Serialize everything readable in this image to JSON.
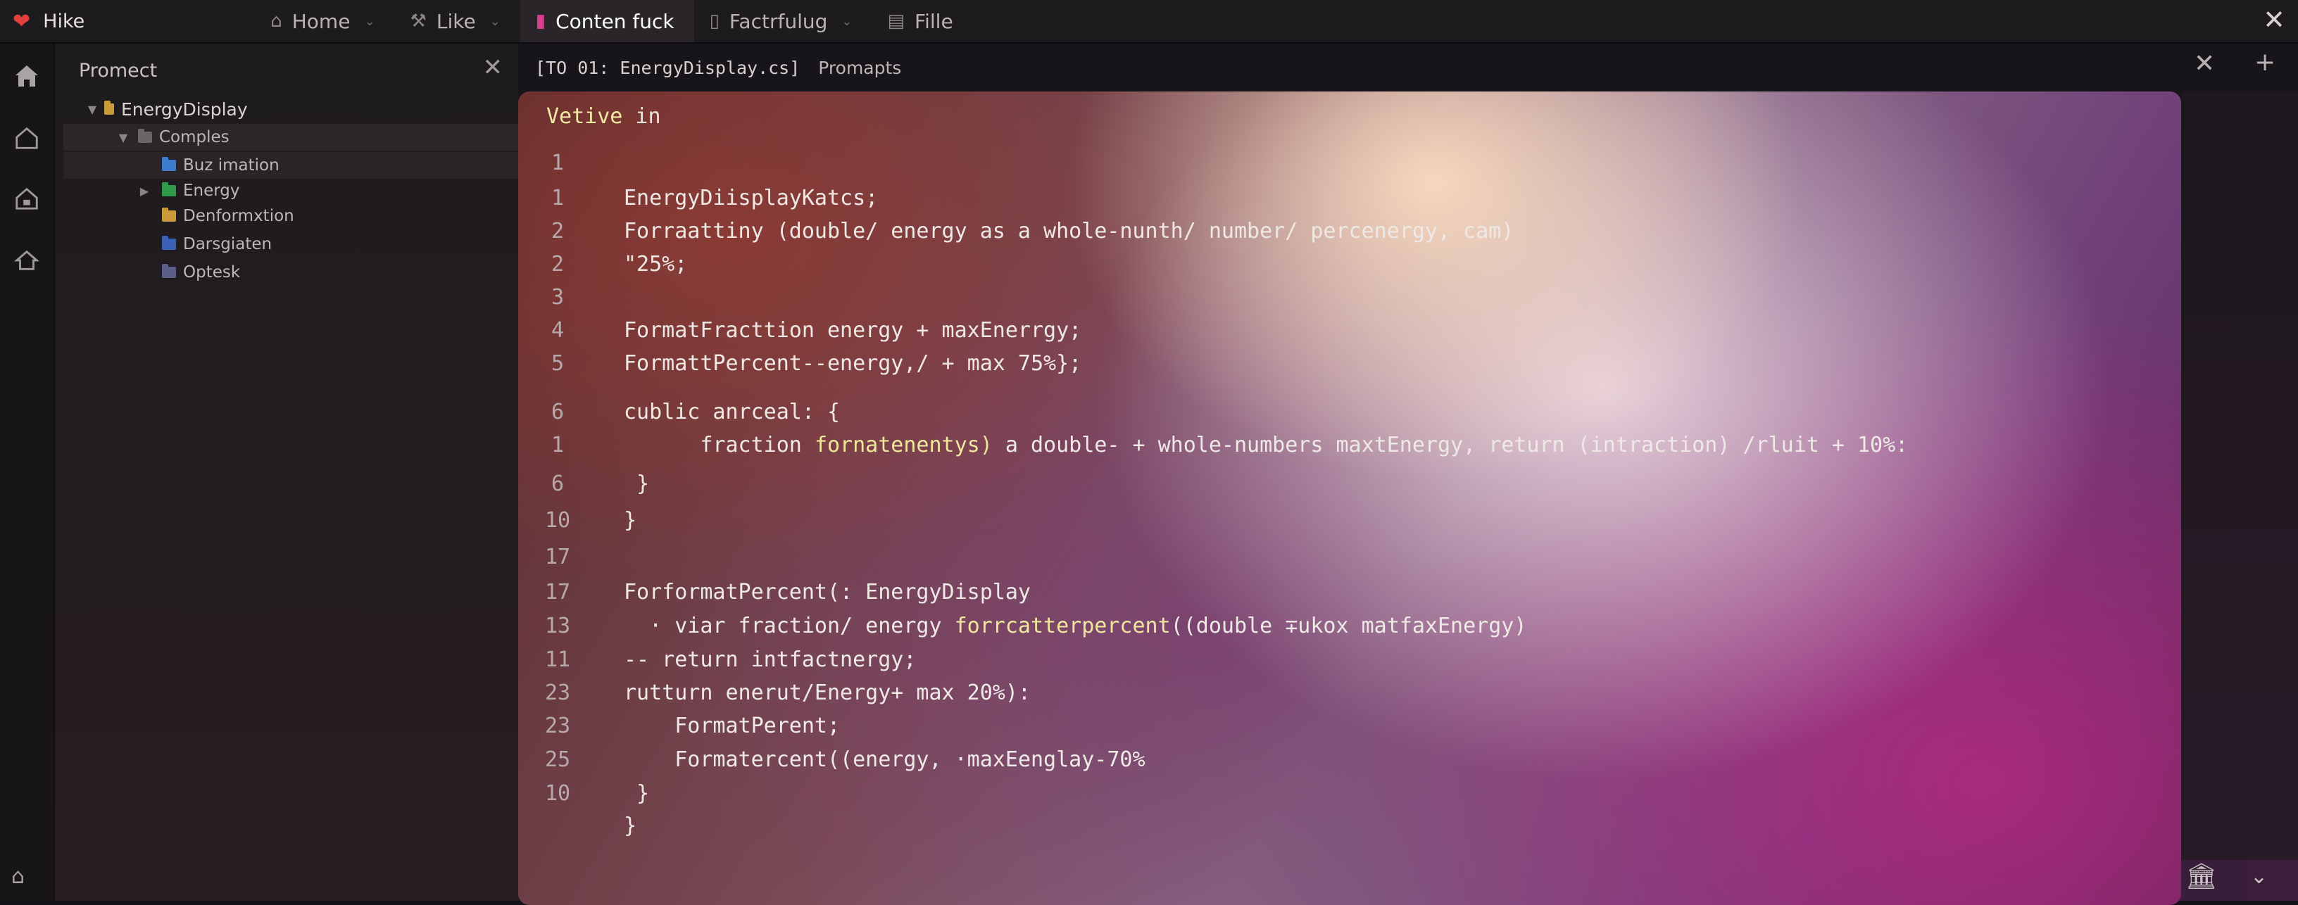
{
  "app": {
    "name": "Hike"
  },
  "tabs": [
    {
      "label": "Home",
      "icon": "home-icon",
      "chevron": true
    },
    {
      "label": "Like",
      "icon": "hammer-icon",
      "chevron": true
    },
    {
      "label": "Conten fuck",
      "icon": "bookmark-icon",
      "active": true,
      "chevron": false
    },
    {
      "label": "Factrfulug",
      "icon": "tablet-icon",
      "chevron": true
    },
    {
      "label": "Fille",
      "icon": "file-icon",
      "chevron": false
    }
  ],
  "sidebar": {
    "title": "Promect",
    "tree": [
      {
        "label": "EnergyDisplay",
        "expanded": true,
        "color": "#c99a3a"
      },
      {
        "label": "Comples",
        "expanded": true,
        "color": "#6b6566"
      },
      {
        "label": "Buz imation",
        "color": "#3c7bd0"
      },
      {
        "label": "Energy",
        "collapsed": true,
        "color": "#2f9a4a"
      },
      {
        "label": "Denformxtion",
        "color": "#c99a3a"
      },
      {
        "label": "Darsgiaten",
        "color": "#3c62b8"
      },
      {
        "label": "Optesk",
        "color": "#5a5f8a"
      }
    ]
  },
  "editor": {
    "tab_file": "[TO 01: EnergyDisplay.cs]",
    "tab_secondary": "Promapts",
    "heading_keyword": "Vetive",
    "heading_rest": " in",
    "lines": [
      {
        "n": "1",
        "code": ""
      },
      {
        "n": "1",
        "code": "EnergyDiisplayKatcs;"
      },
      {
        "n": "2",
        "code": "Forraattiny (double/ energy as a whole-nunth/ number/ percenergy, cam)"
      },
      {
        "n": "2",
        "code": "\"25%;"
      },
      {
        "n": "3",
        "code": ""
      },
      {
        "n": "4",
        "code": "FormatFracttion energy + maxEnerrgy;"
      },
      {
        "n": "5",
        "code": "FormattPercent--energy,/ + max 75%};"
      },
      {
        "n": "6",
        "code": "cublic anrceal: {"
      },
      {
        "n": "1",
        "pre": "      fraction ",
        "hl": "fornatenentys)",
        "post": " a double- + whole-numbers maxtEnergy, return (intraction) /rluit + 10%:"
      },
      {
        "n": "6",
        "code": " }"
      },
      {
        "n": "10",
        "code": "}"
      },
      {
        "n": "17",
        "code": ""
      },
      {
        "n": "17",
        "code": "ForformatPercent(: EnergyDisplay"
      },
      {
        "n": "13",
        "pre": "  · viar fraction/ energy ",
        "hl": "forrcatterpercent",
        "post": "((double ∓ukox matfaxEnergy)"
      },
      {
        "n": "11",
        "code": "-- return intfactnergy;"
      },
      {
        "n": "23",
        "code": "rutturn enerut/Energy+ max 20%):"
      },
      {
        "n": "23",
        "code": "    FormatPerent;"
      },
      {
        "n": "25",
        "code": "    Formatercent((energy, ·maxEenglay-70%"
      },
      {
        "n": "10",
        "code": " }"
      },
      {
        "n": "",
        "code": "}"
      }
    ]
  }
}
